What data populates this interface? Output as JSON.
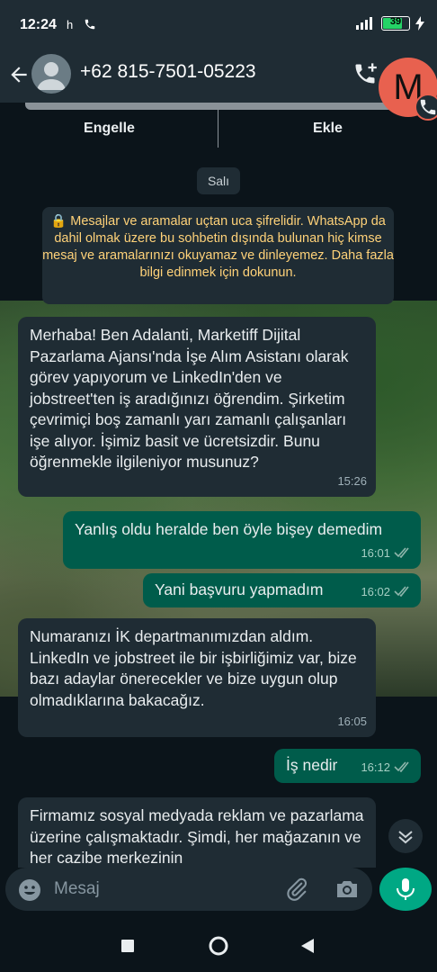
{
  "status_bar": {
    "time": "12:24",
    "indicator": "h",
    "battery": "39"
  },
  "header": {
    "contact": "+62 815-7501-05223",
    "profile_initial": "M"
  },
  "actions": {
    "block": "Engelle",
    "add": "Ekle"
  },
  "chat": {
    "date": "Salı",
    "encryption_notice": "🔒 Mesajlar ve aramalar uçtan uca şifrelidir. WhatsApp da dahil olmak üzere bu sohbetin dışında bulunan hiç kimse mesaj ve aramalarınızı okuyamaz ve dinleyemez. Daha fazla bilgi edinmek için dokunun.",
    "messages": [
      {
        "dir": "in",
        "text": "Merhaba! Ben Adalanti, Marketiff Dijital Pazarlama Ajansı'nda İşe Alım Asistanı olarak görev yapıyorum ve LinkedIn'den ve jobstreet'ten iş aradığınızı öğrendim. Şirketim çevrimiçi boş zamanlı yarı zamanlı çalışanları işe alıyor. İşimiz basit ve ücretsizdir. Bunu öğrenmekle ilgileniyor musunuz?",
        "time": "15:26"
      },
      {
        "dir": "out",
        "text": "Yanlış oldu heralde ben öyle bişey demedim",
        "time": "16:01"
      },
      {
        "dir": "out",
        "text": "Yani başvuru yapmadım",
        "time": "16:02"
      },
      {
        "dir": "in",
        "text": "Numaranızı İK departmanımızdan aldım. LinkedIn ve jobstreet ile bir işbirliğimiz var, bize bazı adaylar önerecekler ve bize uygun olup olmadıklarına bakacağız.",
        "time": "16:05"
      },
      {
        "dir": "out",
        "text": "İş nedir",
        "time": "16:12"
      },
      {
        "dir": "in",
        "text": "Firmamız sosyal medyada reklam ve pazarlama üzerine çalışmaktadır. Şimdi, her mağazanın ve her cazibe merkezinin",
        "time": ""
      }
    ]
  },
  "input": {
    "placeholder": "Mesaj"
  },
  "colors": {
    "background": "#0b141a",
    "bar": "#1f2c34",
    "outgoing": "#005c4b",
    "accent": "#00a884",
    "notice": "#ffd279"
  }
}
